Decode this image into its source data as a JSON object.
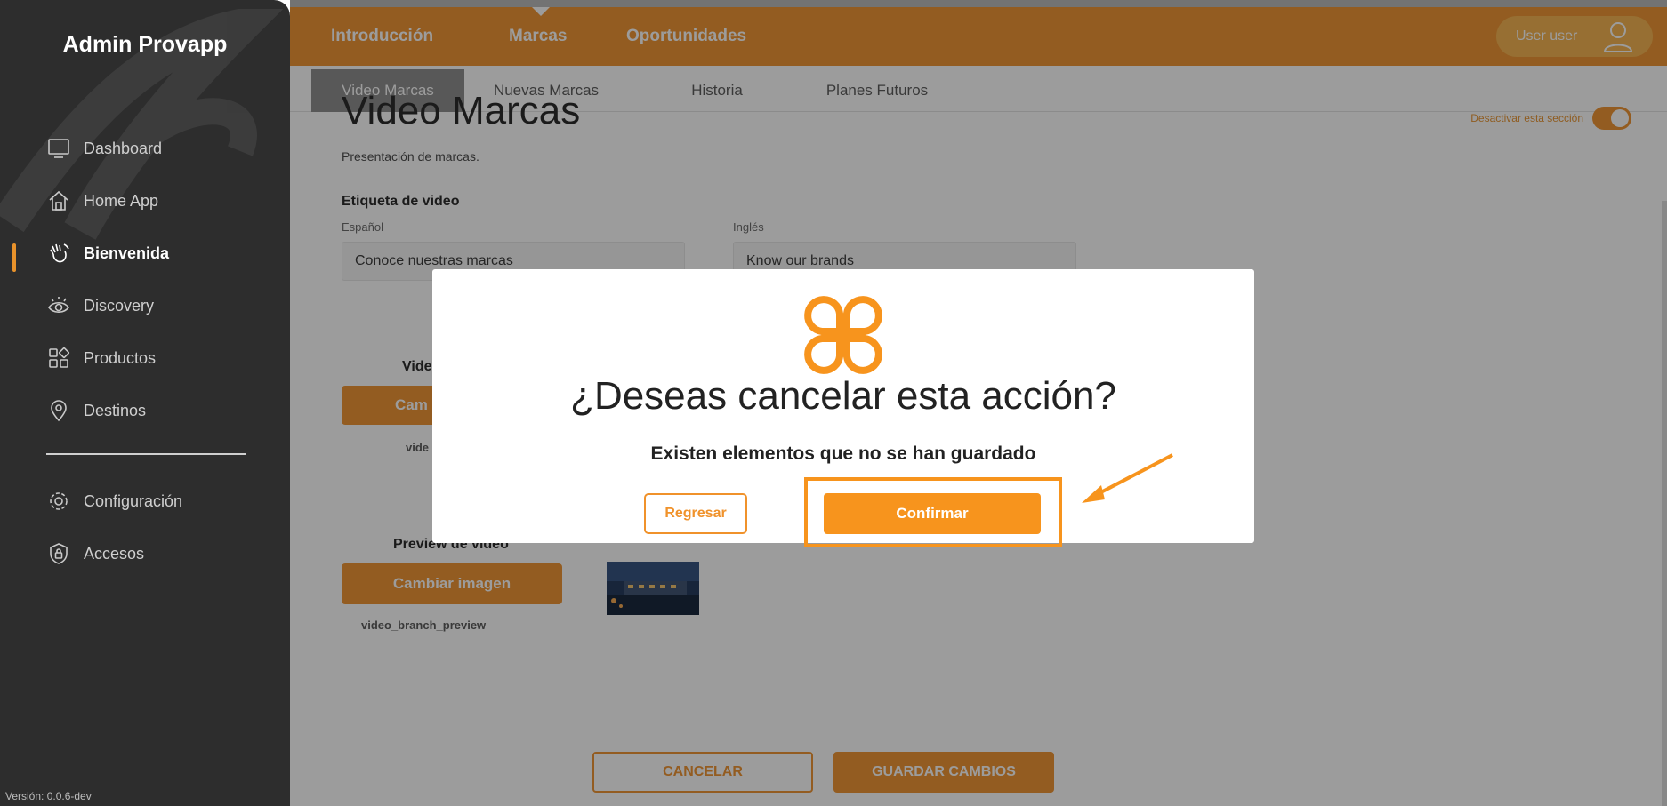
{
  "sidebar": {
    "app_title": "Admin Provapp",
    "items": [
      {
        "label": "Dashboard",
        "icon": "monitor-icon"
      },
      {
        "label": "Home App",
        "icon": "home-icon"
      },
      {
        "label": "Bienvenida",
        "icon": "wave-hand-icon",
        "active": true
      },
      {
        "label": "Discovery",
        "icon": "eye-icon"
      },
      {
        "label": "Productos",
        "icon": "grid-shapes-icon"
      },
      {
        "label": "Destinos",
        "icon": "location-pin-icon"
      }
    ],
    "bottom_items": [
      {
        "label": "Configuración",
        "icon": "gear-icon"
      },
      {
        "label": "Accesos",
        "icon": "shield-lock-icon"
      }
    ],
    "version": "Versión: 0.0.6-dev"
  },
  "topbar": {
    "nav": [
      "Introducción",
      "Marcas",
      "Oportunidades"
    ],
    "active_nav": "Marcas",
    "user_label": "User user"
  },
  "subtabs": {
    "items": [
      "Video Marcas",
      "Nuevas Marcas",
      "Historia",
      "Planes Futuros"
    ],
    "active": "Video Marcas"
  },
  "main": {
    "title": "Video Marcas",
    "subtitle": "Presentación de marcas.",
    "toggle_label": "Desactivar esta sección",
    "video_label_section": "Etiqueta de video",
    "spanish_label": "Español",
    "english_label": "Inglés",
    "spanish_value": "Conoce nuestras marcas",
    "english_value": "Know our brands",
    "video_section_partial": "Vide",
    "change_video_partial": "Cam",
    "video_caption_partial": "vide",
    "preview_section": "Preview de video",
    "change_image_button": "Cambiar imagen",
    "preview_caption": "video_branch_preview",
    "cancel_button": "CANCELAR",
    "save_button": "GUARDAR CAMBIOS"
  },
  "modal": {
    "title": "¿Deseas cancelar esta acción?",
    "message": "Existen elementos que no se han guardado",
    "back_button": "Regresar",
    "confirm_button": "Confirmar"
  },
  "colors": {
    "accent": "#f0922b",
    "sidebar_bg": "#2d2d2d",
    "confirm": "#f7941d"
  }
}
